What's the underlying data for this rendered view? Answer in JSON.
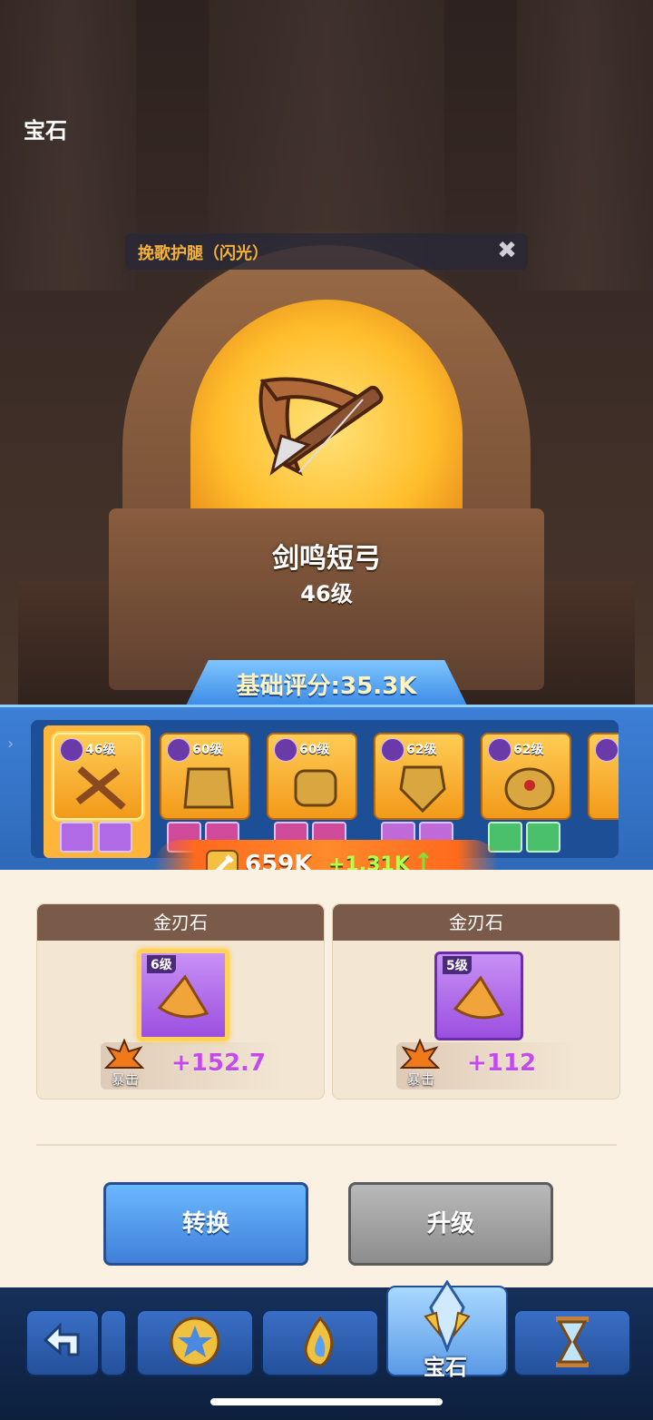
{
  "header": {
    "title": "宝石"
  },
  "notice": {
    "text": "挽歌护腿（闪光）",
    "close_icon": "close-icon"
  },
  "weapon": {
    "name": "剑鸣短弓",
    "level": "46级"
  },
  "score": {
    "label": "基础评分:35.3K"
  },
  "gear_list": [
    {
      "level": "46级",
      "item": "crossbow",
      "selected": true,
      "slot_color": "#b06ae6"
    },
    {
      "level": "60级",
      "item": "golden-armor",
      "selected": false,
      "slot_color": "#d04a9a"
    },
    {
      "level": "60级",
      "item": "golden-gauntlet",
      "selected": false,
      "slot_color": "#d04a9a"
    },
    {
      "level": "62级",
      "item": "golden-chestplate",
      "selected": false,
      "slot_color": "#c06ad8"
    },
    {
      "level": "62级",
      "item": "golden-shoulder",
      "selected": false,
      "slot_color": "#4ac06a"
    }
  ],
  "power": {
    "value": "659K",
    "delta": "+1.31K",
    "arrow": "↑"
  },
  "gems": [
    {
      "name": "金刃石",
      "level": "6级",
      "stat_label": "暴击",
      "stat_value": "+152.7",
      "selected": true
    },
    {
      "name": "金刃石",
      "level": "5级",
      "stat_label": "暴击",
      "stat_value": "+112",
      "selected": false
    }
  ],
  "buttons": {
    "convert": "转换",
    "upgrade": "升级"
  },
  "nav": {
    "items": [
      "back-arrow-icon",
      "star-medal-icon",
      "flame-icon",
      "gem-crystal-icon",
      "hourglass-icon"
    ],
    "active_label": "宝石"
  },
  "colors": {
    "accent_blue": "#3f7fd8",
    "gem_purple": "#9b4fe0",
    "stat_pink": "#c64ae8",
    "notice_gold": "#f5b23a"
  }
}
